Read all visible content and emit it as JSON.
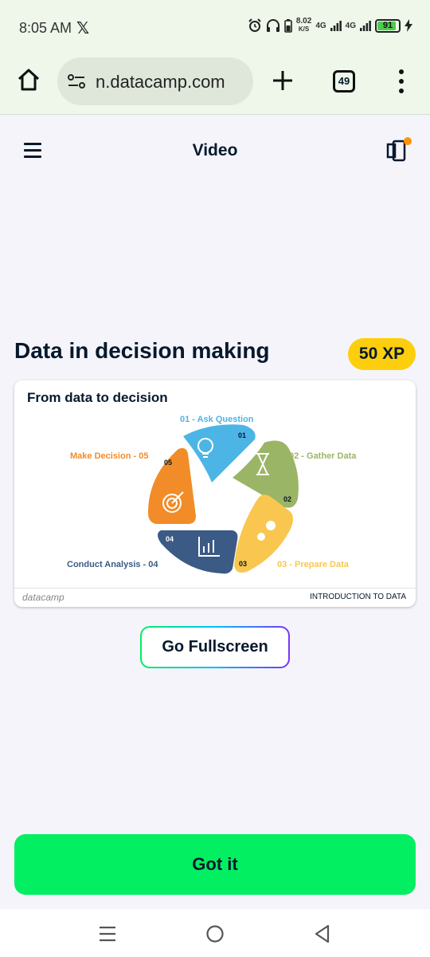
{
  "status_bar": {
    "time": "8:05 AM",
    "x_app": "𝕏",
    "speed_value": "8.02",
    "speed_unit": "K/S",
    "net1": "4G",
    "net2": "4G",
    "battery": "91",
    "battery_level": 0.91
  },
  "browser": {
    "url": "n.datacamp.com",
    "tab_count": "49"
  },
  "app_header": {
    "title": "Video"
  },
  "lesson": {
    "title": "Data in decision making",
    "xp": "50 XP"
  },
  "slide": {
    "title": "From data to decision",
    "steps": [
      {
        "label": "01 - Ask Question",
        "num": "01",
        "color": "#4cb5e6",
        "icon": "lightbulb-icon"
      },
      {
        "label": "02 - Gather Data",
        "num": "02",
        "color": "#9bb566",
        "icon": "hourglass-icon"
      },
      {
        "label": "03 - Prepare Data",
        "num": "03",
        "color": "#f9c74f",
        "icon": "gears-icon"
      },
      {
        "label": "Conduct Analysis - 04",
        "num": "04",
        "color": "#3b5a85",
        "icon": "bar-chart-icon"
      },
      {
        "label": "Make Decision - 05",
        "num": "05",
        "color": "#f28c28",
        "icon": "target-icon"
      }
    ],
    "logo": "datacamp",
    "course": "INTRODUCTION TO DATA"
  },
  "buttons": {
    "fullscreen": "Go Fullscreen",
    "got_it": "Got it"
  },
  "colors": {
    "brand_green": "#03ef62",
    "xp_yellow": "#fcce0d",
    "navy": "#05192d",
    "notification_orange": "#ff9400"
  }
}
